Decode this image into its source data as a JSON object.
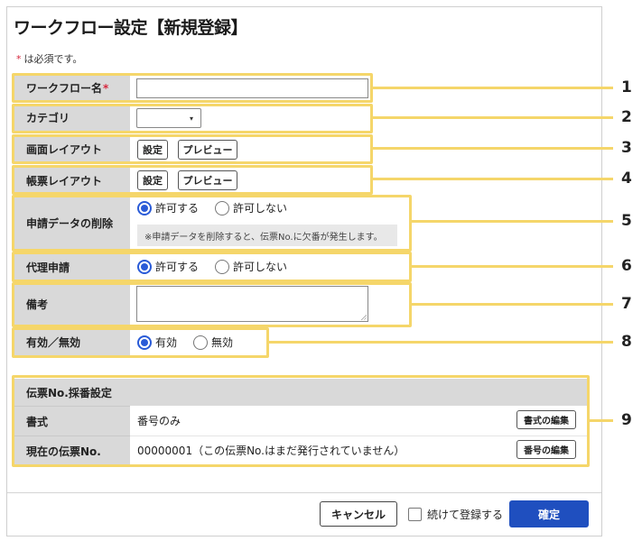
{
  "title": "ワークフロー設定【新規登録】",
  "required_note": {
    "star": "*",
    "text": "は必須です。"
  },
  "fields": {
    "workflow_name": {
      "label": "ワークフロー名",
      "required_mark": "*",
      "value": ""
    },
    "category": {
      "label": "カテゴリ",
      "selected": "",
      "arrow": "▾"
    },
    "screen_layout": {
      "label": "画面レイアウト",
      "settings": "設定",
      "preview": "プレビュー"
    },
    "form_layout": {
      "label": "帳票レイアウト",
      "settings": "設定",
      "preview": "プレビュー"
    },
    "delete_application": {
      "label": "申請データの削除",
      "allow": "許可する",
      "deny": "許可しない",
      "selected": "allow",
      "note": "※申請データを削除すると、伝票No.に欠番が発生します。"
    },
    "proxy_application": {
      "label": "代理申請",
      "allow": "許可する",
      "deny": "許可しない",
      "selected": "allow"
    },
    "remarks": {
      "label": "備考",
      "value": ""
    },
    "enabled": {
      "label": "有効／無効",
      "on": "有効",
      "off": "無効",
      "selected": "on"
    }
  },
  "numbering": {
    "header": "伝票No.採番設定",
    "format": {
      "label": "書式",
      "value": "番号のみ",
      "button": "書式の編集"
    },
    "current": {
      "label": "現在の伝票No.",
      "value": "00000001（この伝票No.はまだ発行されていません）",
      "button": "番号の編集"
    }
  },
  "footer": {
    "cancel": "キャンセル",
    "continue_register": "続けて登録する",
    "confirm": "確定"
  },
  "callouts": [
    "1",
    "2",
    "3",
    "4",
    "5",
    "6",
    "7",
    "8",
    "9"
  ],
  "colors": {
    "accent": "#1f4fbf",
    "radio": "#2a5bd7",
    "required": "#d6263d",
    "highlight": "#f5d66a",
    "label_bg": "#d9d9d9"
  }
}
